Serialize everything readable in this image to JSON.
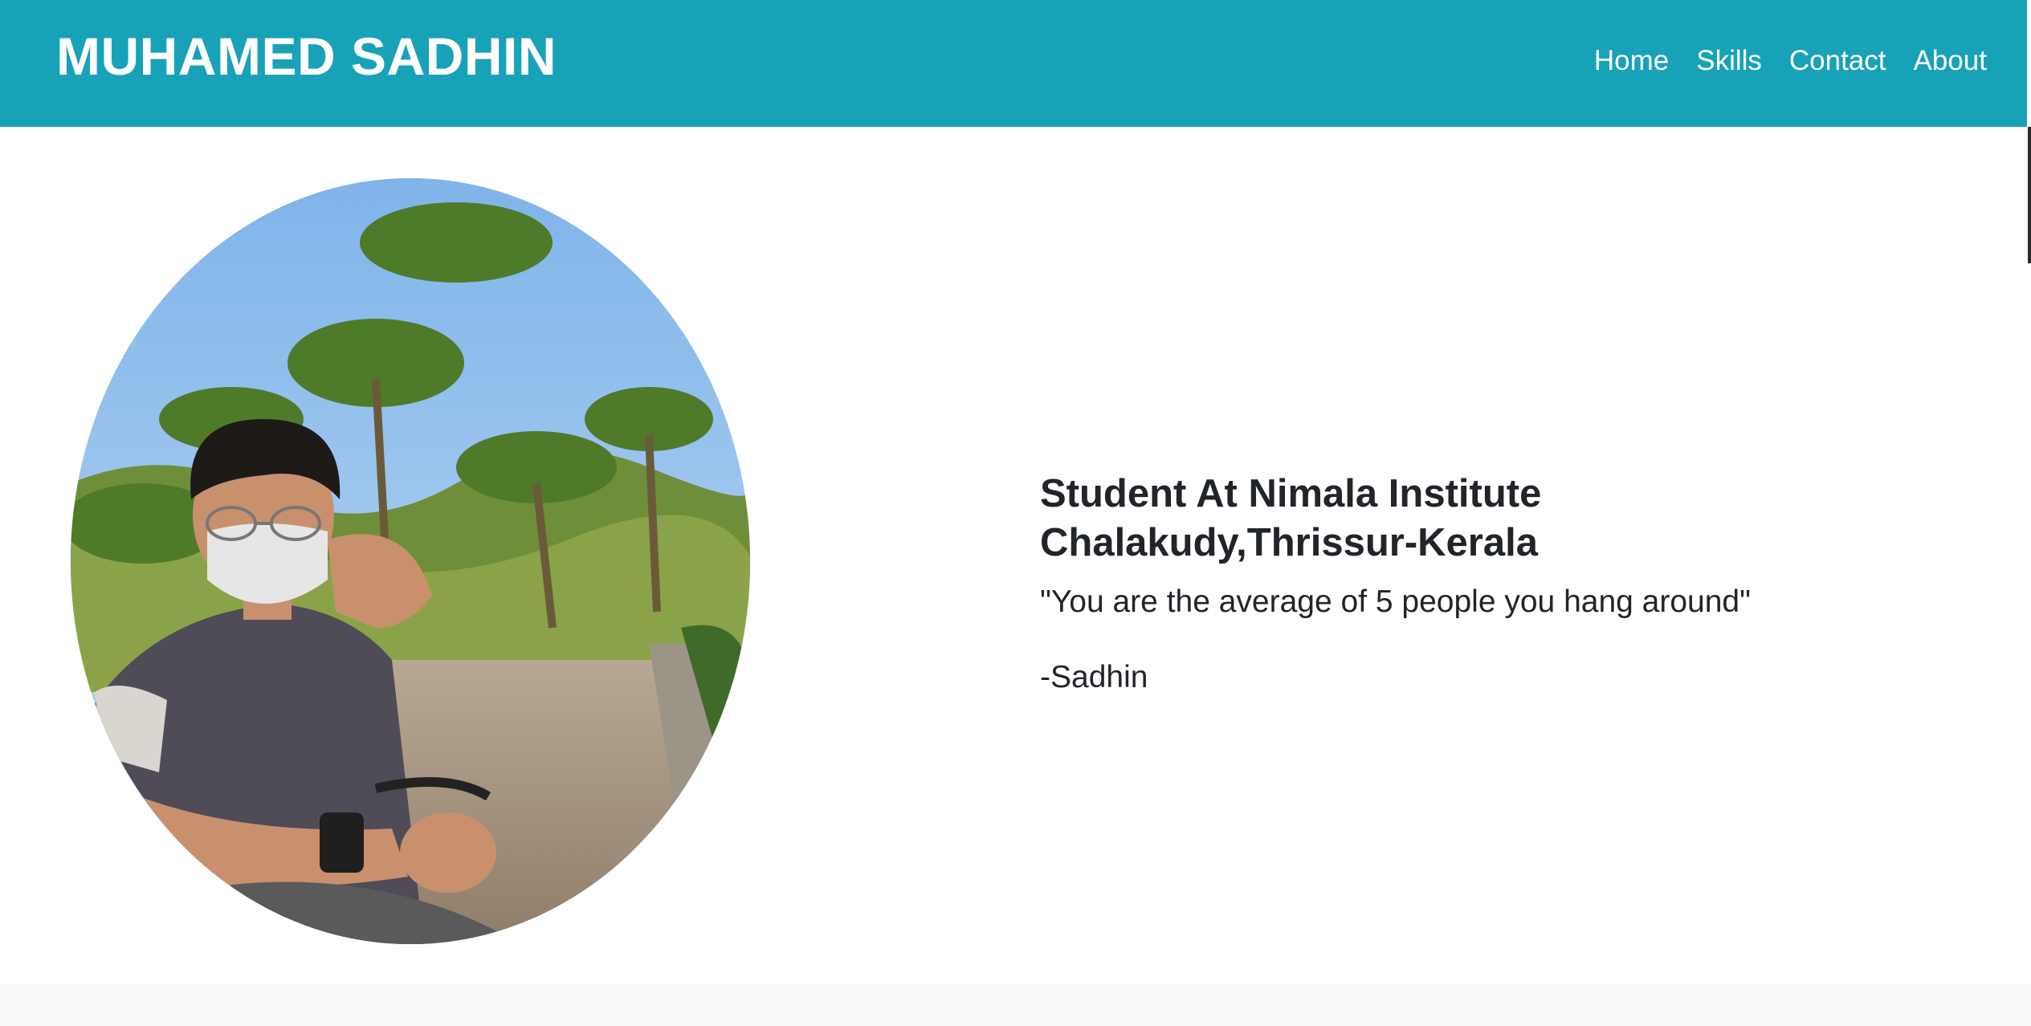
{
  "navbar": {
    "brand": "MUHAMED SADHIN",
    "links": [
      "Home",
      "Skills",
      "Contact",
      "About"
    ]
  },
  "hero": {
    "photo_alt": "profile-photo",
    "title_line1": "Student At Nimala Institute",
    "title_line2": "Chalakudy,Thrissur-Kerala",
    "quote": "\"You are the average of 5 people you hang around\"",
    "author": "-Sadhin"
  },
  "colors": {
    "navbar_bg": "#17a2b8",
    "text": "#212529",
    "footer_bg": "#f8f9fa"
  }
}
